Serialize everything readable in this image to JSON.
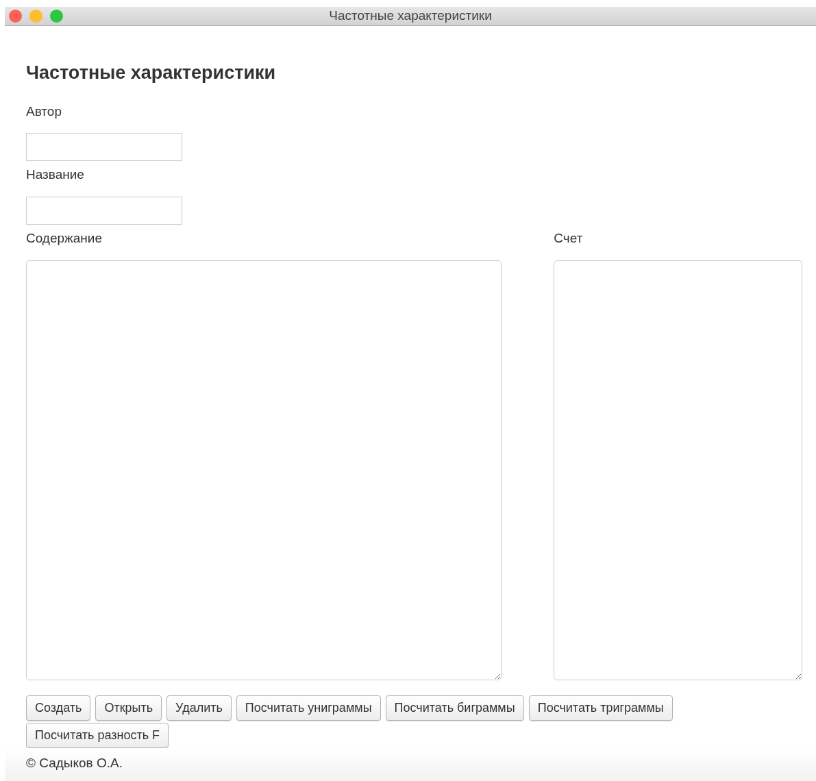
{
  "window": {
    "title": "Частотные характеристики"
  },
  "heading": "Частотные характеристики",
  "fields": [
    {
      "label": "Автор"
    },
    {
      "label": "Название"
    }
  ],
  "content": {
    "label": "Содержание"
  },
  "score": {
    "label": "Счет"
  },
  "buttons": [
    "Создать",
    "Открыть",
    "Удалить",
    "Посчитать униграммы",
    "Посчитать биграммы",
    "Посчитать триграммы",
    "Посчитать разность F"
  ],
  "footer": "© Садыков О.А."
}
